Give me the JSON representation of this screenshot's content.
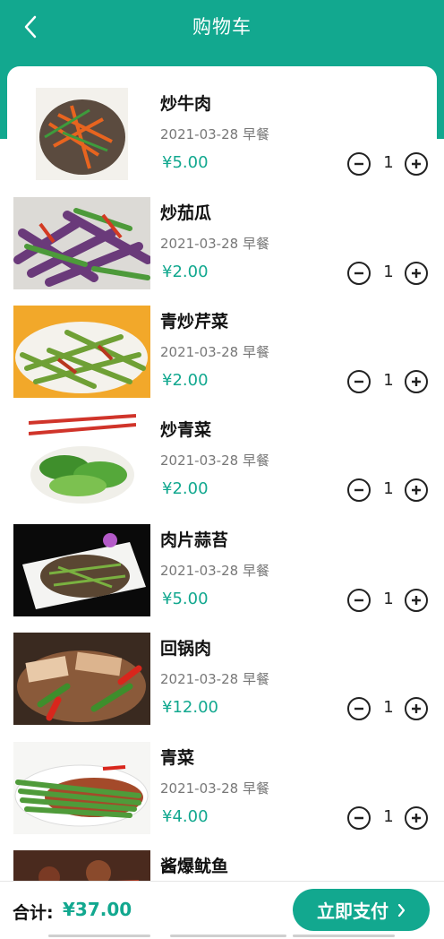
{
  "header": {
    "title": "购物车",
    "back_icon": "chevron-left-icon"
  },
  "items": [
    {
      "name": "炒牛肉",
      "date": "2021-03-28",
      "meal": "早餐",
      "price": "¥5.00",
      "qty": "1"
    },
    {
      "name": "炒茄瓜",
      "date": "2021-03-28",
      "meal": "早餐",
      "price": "¥2.00",
      "qty": "1"
    },
    {
      "name": "青炒芹菜",
      "date": "2021-03-28",
      "meal": "早餐",
      "price": "¥2.00",
      "qty": "1"
    },
    {
      "name": "炒青菜",
      "date": "2021-03-28",
      "meal": "早餐",
      "price": "¥2.00",
      "qty": "1"
    },
    {
      "name": "肉片蒜苔",
      "date": "2021-03-28",
      "meal": "早餐",
      "price": "¥5.00",
      "qty": "1"
    },
    {
      "name": "回锅肉",
      "date": "2021-03-28",
      "meal": "早餐",
      "price": "¥12.00",
      "qty": "1"
    },
    {
      "name": "青菜",
      "date": "2021-03-28",
      "meal": "早餐",
      "price": "¥4.00",
      "qty": "1"
    },
    {
      "name": "酱爆鱿鱼"
    }
  ],
  "footer": {
    "total_label": "合计:",
    "total_value": "¥37.00",
    "pay_label": "立即支付"
  },
  "colors": {
    "accent": "#12a88f"
  }
}
